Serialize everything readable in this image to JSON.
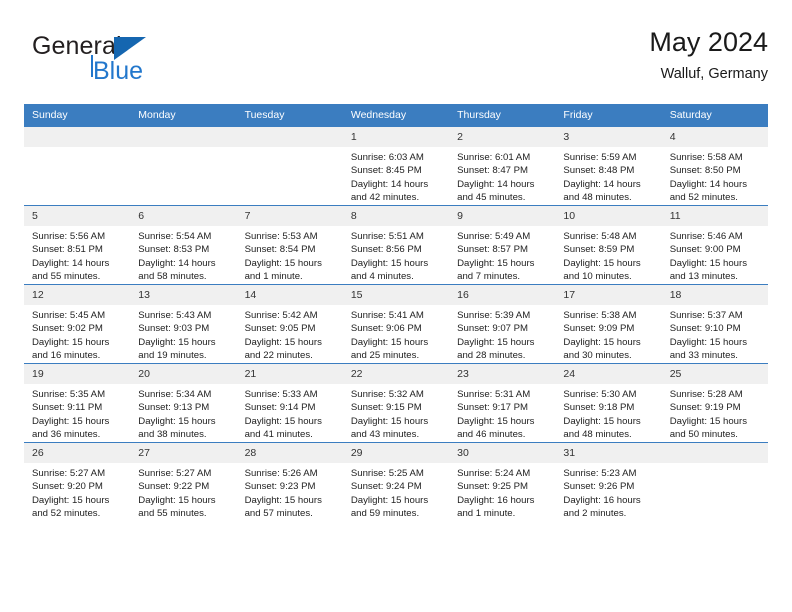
{
  "brand": {
    "word_general": "General",
    "word_blue": "Blue",
    "flag_icon": "triangle-flag-icon"
  },
  "header": {
    "title": "May 2024",
    "subtitle": "Walluf, Germany"
  },
  "calendar": {
    "weekday_headers": [
      "Sunday",
      "Monday",
      "Tuesday",
      "Wednesday",
      "Thursday",
      "Friday",
      "Saturday"
    ],
    "header_bg": "#3b7dc0",
    "daynum_bg": "#f0f0f0",
    "labels": {
      "sunrise": "Sunrise:",
      "sunset": "Sunset:",
      "daylight": "Daylight:"
    },
    "weeks": [
      [
        {
          "day": "",
          "empty": true
        },
        {
          "day": "",
          "empty": true
        },
        {
          "day": "",
          "empty": true
        },
        {
          "day": "1",
          "sunrise": "Sunrise: 6:03 AM",
          "sunset": "Sunset: 8:45 PM",
          "daylight1": "Daylight: 14 hours",
          "daylight2": "and 42 minutes."
        },
        {
          "day": "2",
          "sunrise": "Sunrise: 6:01 AM",
          "sunset": "Sunset: 8:47 PM",
          "daylight1": "Daylight: 14 hours",
          "daylight2": "and 45 minutes."
        },
        {
          "day": "3",
          "sunrise": "Sunrise: 5:59 AM",
          "sunset": "Sunset: 8:48 PM",
          "daylight1": "Daylight: 14 hours",
          "daylight2": "and 48 minutes."
        },
        {
          "day": "4",
          "sunrise": "Sunrise: 5:58 AM",
          "sunset": "Sunset: 8:50 PM",
          "daylight1": "Daylight: 14 hours",
          "daylight2": "and 52 minutes."
        }
      ],
      [
        {
          "day": "5",
          "sunrise": "Sunrise: 5:56 AM",
          "sunset": "Sunset: 8:51 PM",
          "daylight1": "Daylight: 14 hours",
          "daylight2": "and 55 minutes."
        },
        {
          "day": "6",
          "sunrise": "Sunrise: 5:54 AM",
          "sunset": "Sunset: 8:53 PM",
          "daylight1": "Daylight: 14 hours",
          "daylight2": "and 58 minutes."
        },
        {
          "day": "7",
          "sunrise": "Sunrise: 5:53 AM",
          "sunset": "Sunset: 8:54 PM",
          "daylight1": "Daylight: 15 hours",
          "daylight2": "and 1 minute."
        },
        {
          "day": "8",
          "sunrise": "Sunrise: 5:51 AM",
          "sunset": "Sunset: 8:56 PM",
          "daylight1": "Daylight: 15 hours",
          "daylight2": "and 4 minutes."
        },
        {
          "day": "9",
          "sunrise": "Sunrise: 5:49 AM",
          "sunset": "Sunset: 8:57 PM",
          "daylight1": "Daylight: 15 hours",
          "daylight2": "and 7 minutes."
        },
        {
          "day": "10",
          "sunrise": "Sunrise: 5:48 AM",
          "sunset": "Sunset: 8:59 PM",
          "daylight1": "Daylight: 15 hours",
          "daylight2": "and 10 minutes."
        },
        {
          "day": "11",
          "sunrise": "Sunrise: 5:46 AM",
          "sunset": "Sunset: 9:00 PM",
          "daylight1": "Daylight: 15 hours",
          "daylight2": "and 13 minutes."
        }
      ],
      [
        {
          "day": "12",
          "sunrise": "Sunrise: 5:45 AM",
          "sunset": "Sunset: 9:02 PM",
          "daylight1": "Daylight: 15 hours",
          "daylight2": "and 16 minutes."
        },
        {
          "day": "13",
          "sunrise": "Sunrise: 5:43 AM",
          "sunset": "Sunset: 9:03 PM",
          "daylight1": "Daylight: 15 hours",
          "daylight2": "and 19 minutes."
        },
        {
          "day": "14",
          "sunrise": "Sunrise: 5:42 AM",
          "sunset": "Sunset: 9:05 PM",
          "daylight1": "Daylight: 15 hours",
          "daylight2": "and 22 minutes."
        },
        {
          "day": "15",
          "sunrise": "Sunrise: 5:41 AM",
          "sunset": "Sunset: 9:06 PM",
          "daylight1": "Daylight: 15 hours",
          "daylight2": "and 25 minutes."
        },
        {
          "day": "16",
          "sunrise": "Sunrise: 5:39 AM",
          "sunset": "Sunset: 9:07 PM",
          "daylight1": "Daylight: 15 hours",
          "daylight2": "and 28 minutes."
        },
        {
          "day": "17",
          "sunrise": "Sunrise: 5:38 AM",
          "sunset": "Sunset: 9:09 PM",
          "daylight1": "Daylight: 15 hours",
          "daylight2": "and 30 minutes."
        },
        {
          "day": "18",
          "sunrise": "Sunrise: 5:37 AM",
          "sunset": "Sunset: 9:10 PM",
          "daylight1": "Daylight: 15 hours",
          "daylight2": "and 33 minutes."
        }
      ],
      [
        {
          "day": "19",
          "sunrise": "Sunrise: 5:35 AM",
          "sunset": "Sunset: 9:11 PM",
          "daylight1": "Daylight: 15 hours",
          "daylight2": "and 36 minutes."
        },
        {
          "day": "20",
          "sunrise": "Sunrise: 5:34 AM",
          "sunset": "Sunset: 9:13 PM",
          "daylight1": "Daylight: 15 hours",
          "daylight2": "and 38 minutes."
        },
        {
          "day": "21",
          "sunrise": "Sunrise: 5:33 AM",
          "sunset": "Sunset: 9:14 PM",
          "daylight1": "Daylight: 15 hours",
          "daylight2": "and 41 minutes."
        },
        {
          "day": "22",
          "sunrise": "Sunrise: 5:32 AM",
          "sunset": "Sunset: 9:15 PM",
          "daylight1": "Daylight: 15 hours",
          "daylight2": "and 43 minutes."
        },
        {
          "day": "23",
          "sunrise": "Sunrise: 5:31 AM",
          "sunset": "Sunset: 9:17 PM",
          "daylight1": "Daylight: 15 hours",
          "daylight2": "and 46 minutes."
        },
        {
          "day": "24",
          "sunrise": "Sunrise: 5:30 AM",
          "sunset": "Sunset: 9:18 PM",
          "daylight1": "Daylight: 15 hours",
          "daylight2": "and 48 minutes."
        },
        {
          "day": "25",
          "sunrise": "Sunrise: 5:28 AM",
          "sunset": "Sunset: 9:19 PM",
          "daylight1": "Daylight: 15 hours",
          "daylight2": "and 50 minutes."
        }
      ],
      [
        {
          "day": "26",
          "sunrise": "Sunrise: 5:27 AM",
          "sunset": "Sunset: 9:20 PM",
          "daylight1": "Daylight: 15 hours",
          "daylight2": "and 52 minutes."
        },
        {
          "day": "27",
          "sunrise": "Sunrise: 5:27 AM",
          "sunset": "Sunset: 9:22 PM",
          "daylight1": "Daylight: 15 hours",
          "daylight2": "and 55 minutes."
        },
        {
          "day": "28",
          "sunrise": "Sunrise: 5:26 AM",
          "sunset": "Sunset: 9:23 PM",
          "daylight1": "Daylight: 15 hours",
          "daylight2": "and 57 minutes."
        },
        {
          "day": "29",
          "sunrise": "Sunrise: 5:25 AM",
          "sunset": "Sunset: 9:24 PM",
          "daylight1": "Daylight: 15 hours",
          "daylight2": "and 59 minutes."
        },
        {
          "day": "30",
          "sunrise": "Sunrise: 5:24 AM",
          "sunset": "Sunset: 9:25 PM",
          "daylight1": "Daylight: 16 hours",
          "daylight2": "and 1 minute."
        },
        {
          "day": "31",
          "sunrise": "Sunrise: 5:23 AM",
          "sunset": "Sunset: 9:26 PM",
          "daylight1": "Daylight: 16 hours",
          "daylight2": "and 2 minutes."
        },
        {
          "day": "",
          "empty": true
        }
      ]
    ]
  }
}
